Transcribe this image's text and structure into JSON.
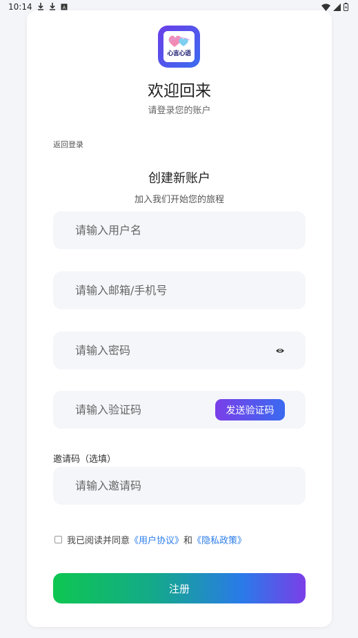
{
  "status_bar": {
    "time": "10:14",
    "left_icons": [
      "download-icon",
      "download-icon",
      "font-icon"
    ],
    "right_icons": [
      "wifi-icon",
      "signal-icon",
      "battery-icon"
    ]
  },
  "app": {
    "logo_text": "心言心语",
    "title": "欢迎回来",
    "subtitle": "请登录您的账户",
    "back_to_login": "返回登录"
  },
  "register_form": {
    "title": "创建新账户",
    "subtitle": "加入我们开始您的旅程",
    "username_placeholder": "请输入用户名",
    "email_phone_placeholder": "请输入邮箱/手机号",
    "password_placeholder": "请输入密码",
    "code_placeholder": "请输入验证码",
    "send_code_label": "发送验证码",
    "invite_label": "邀请码（选填）",
    "invite_placeholder": "请输入邀请码",
    "agree_prefix": "我已阅读并同意",
    "user_agreement": "《用户协议》",
    "and": "和",
    "privacy_policy": "《隐私政策》",
    "submit_label": "注册"
  },
  "colors": {
    "accent_purple": "#7a3ee8",
    "accent_blue": "#3a6af0",
    "accent_green": "#0ec651",
    "link_blue": "#2b7de9"
  }
}
